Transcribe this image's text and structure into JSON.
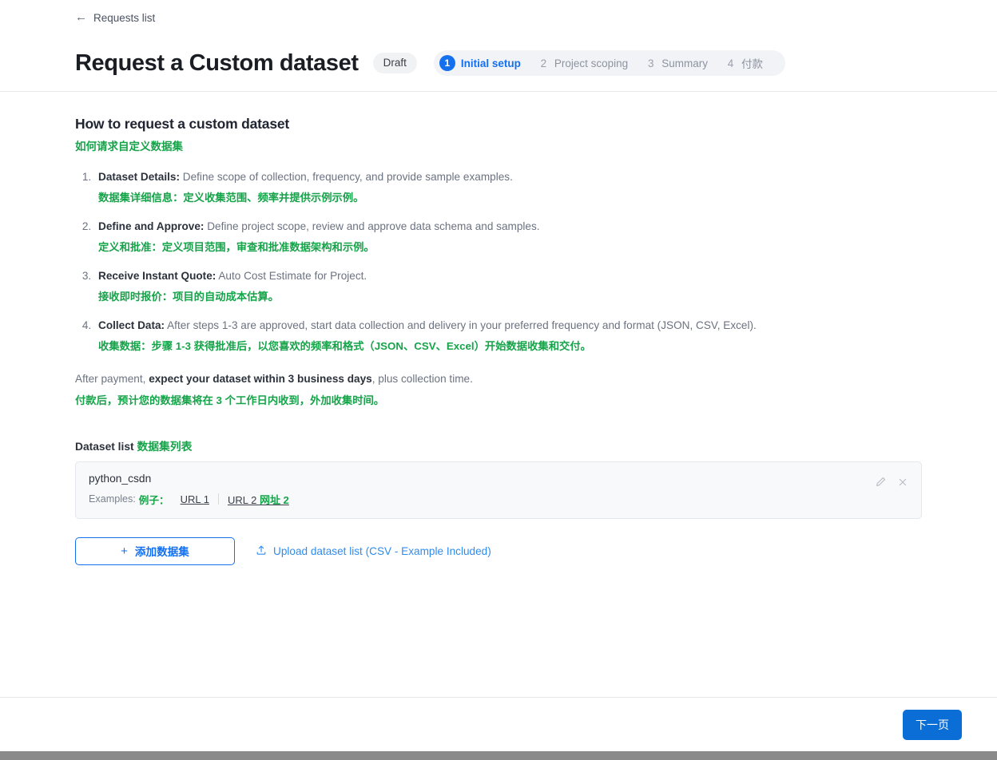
{
  "topbar": {
    "back_label": "Requests list",
    "back_icon": "arrow-left-icon"
  },
  "header": {
    "title": "Request a Custom dataset",
    "draft_badge": "Draft",
    "steps": [
      {
        "num": "1",
        "label": "Initial setup",
        "active": true
      },
      {
        "num": "2",
        "label": "Project scoping",
        "active": false
      },
      {
        "num": "3",
        "label": "Summary",
        "active": false
      },
      {
        "num": "4",
        "label": "付款",
        "active": false
      }
    ]
  },
  "main": {
    "section_title_en": "How to request a custom dataset",
    "section_title_zh": "如何请求自定义数据集",
    "steps_list": [
      {
        "en_bold": "Dataset Details:",
        "en_rest": " Define scope of collection, frequency, and provide sample examples.",
        "zh": "数据集详细信息：定义收集范围、频率并提供示例示例。"
      },
      {
        "en_bold": "Define and Approve:",
        "en_rest": " Define project scope, review and approve data schema and samples.",
        "zh": "定义和批准：定义项目范围，审查和批准数据架构和示例。"
      },
      {
        "en_bold": "Receive Instant Quote:",
        "en_rest": " Auto Cost Estimate for Project.",
        "zh": "接收即时报价：项目的自动成本估算。"
      },
      {
        "en_bold": "Collect Data:",
        "en_rest": " After steps 1-3 are approved, start data collection and delivery in your preferred frequency and format (JSON, CSV, Excel).",
        "zh": "收集数据：步骤 1-3 获得批准后，以您喜欢的频率和格式（JSON、CSV、Excel）开始数据收集和交付。"
      }
    ],
    "after_payment": {
      "prefix": "After payment, ",
      "bold": "expect your dataset within 3 business days",
      "suffix": ", plus collection time.",
      "zh": "付款后，预计您的数据集将在 3 个工作日内收到，外加收集时间。"
    },
    "dataset_list_heading_en": "Dataset list",
    "dataset_list_heading_zh": "数据集列表",
    "dataset_card": {
      "name": "python_csdn",
      "examples_label": "Examples:",
      "examples_label_zh": "例子：",
      "links": [
        {
          "text": "URL 1",
          "zh": ""
        },
        {
          "text": "URL 2 ",
          "zh": "网址 2"
        }
      ],
      "edit_icon": "pencil-icon",
      "remove_icon": "close-icon"
    },
    "add_dataset_button": "添加数据集",
    "add_dataset_plus": "+",
    "upload_link": "Upload dataset list (CSV - Example Included)",
    "upload_icon": "upload-icon"
  },
  "footer": {
    "next_button": "下一页"
  },
  "colors": {
    "accent_blue": "#1570ef",
    "primary_button_blue": "#0b6ed6",
    "translation_green": "#17a34a",
    "muted_text": "#6b7280",
    "card_background": "#f8f9fb"
  }
}
